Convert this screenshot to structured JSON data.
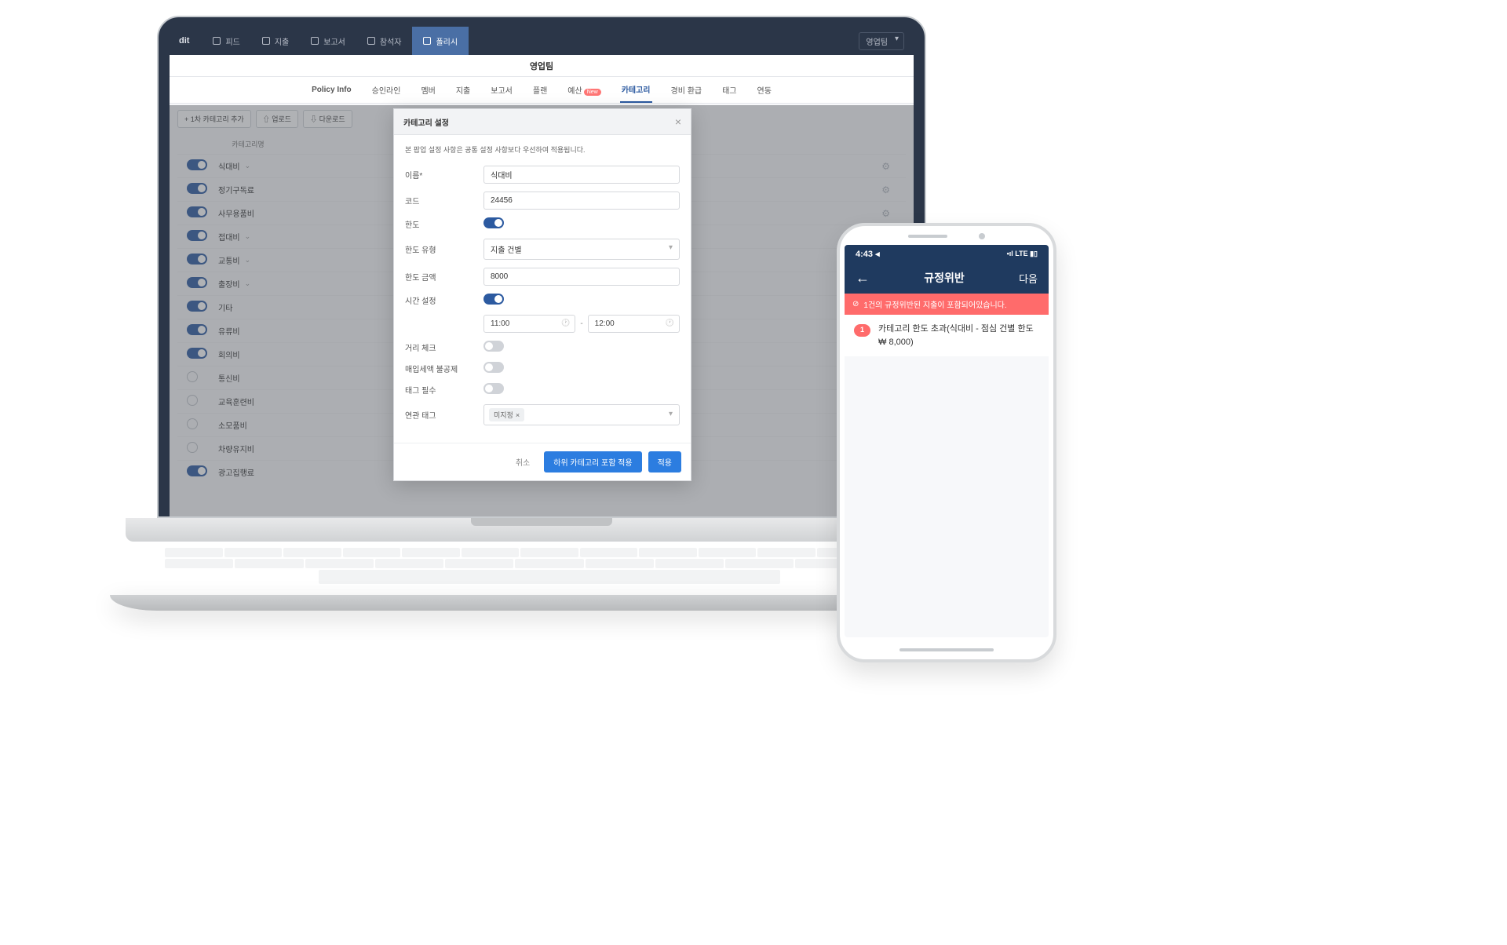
{
  "laptop": {
    "brand": "dit",
    "topnav": {
      "items": [
        "피드",
        "지출",
        "보고서",
        "참석자",
        "폴리시"
      ],
      "active_index": 4,
      "team_select": "영업팀"
    },
    "subheader_title": "영업팀",
    "tabs": {
      "items": [
        "Policy Info",
        "승인라인",
        "멤버",
        "지출",
        "보고서",
        "플랜",
        "예산",
        "카테고리",
        "경비 환급",
        "태그",
        "연동"
      ],
      "active_index": 7,
      "new_badge_index": 6
    },
    "toolbar": {
      "add": "+ 1차 카테고리 추가",
      "upload": "⇧ 업로드",
      "download": "⇩ 다운로드"
    },
    "list_header": {
      "name": "카테고리명"
    },
    "categories": [
      {
        "name": "식대비",
        "on": true,
        "expandable": true
      },
      {
        "name": "정기구독료",
        "on": true
      },
      {
        "name": "사무용품비",
        "on": true
      },
      {
        "name": "접대비",
        "on": true,
        "expandable": true
      },
      {
        "name": "교통비",
        "on": true,
        "expandable": true
      },
      {
        "name": "출장비",
        "on": true,
        "expandable": true
      },
      {
        "name": "기타",
        "on": true
      },
      {
        "name": "유류비",
        "on": true
      },
      {
        "name": "회의비",
        "on": true
      },
      {
        "name": "통신비",
        "on": false,
        "radio": true
      },
      {
        "name": "교육훈련비",
        "on": false,
        "radio": true
      },
      {
        "name": "소모품비",
        "on": false,
        "radio": true
      },
      {
        "name": "차량유지비",
        "on": false,
        "radio": true
      },
      {
        "name": "광고집행료",
        "on": true
      }
    ],
    "modal": {
      "title": "카테고리 설정",
      "description": "본 팝업 설정 사항은 공통 설정 사항보다 우선하여 적용됩니다.",
      "fields": {
        "name_label": "이름*",
        "name_value": "식대비",
        "code_label": "코드",
        "code_value": "24456",
        "limit_label": "한도",
        "limit_on": true,
        "limit_type_label": "한도 유형",
        "limit_type_value": "지출 건별",
        "limit_amount_label": "한도 금액",
        "limit_amount_value": "8000",
        "time_label": "시간 설정",
        "time_on": true,
        "time_from": "11:00",
        "time_to": "12:00",
        "distance_label": "거리 체크",
        "nondeductible_label": "매입세액 불공제",
        "tag_required_label": "태그 필수",
        "related_tag_label": "연관 태그",
        "tag_chip": "미지정"
      },
      "footer": {
        "cancel": "취소",
        "apply_sub": "하위 카테고리 포함 적용",
        "apply": "적용"
      }
    }
  },
  "phone": {
    "status": {
      "time": "4:43 ◂",
      "signal": "•ıl LTE ▮▯"
    },
    "header": {
      "back": "←",
      "title": "규정위반",
      "next": "다음"
    },
    "warning": {
      "icon": "⊘",
      "text": "1건의 규정위반된 지출이 포함되어있습니다."
    },
    "violation": {
      "badge": "1",
      "title": "카테고리 한도 초과(식대비 - 점심 건별 한도",
      "amount": "₩ 8,000)"
    }
  }
}
